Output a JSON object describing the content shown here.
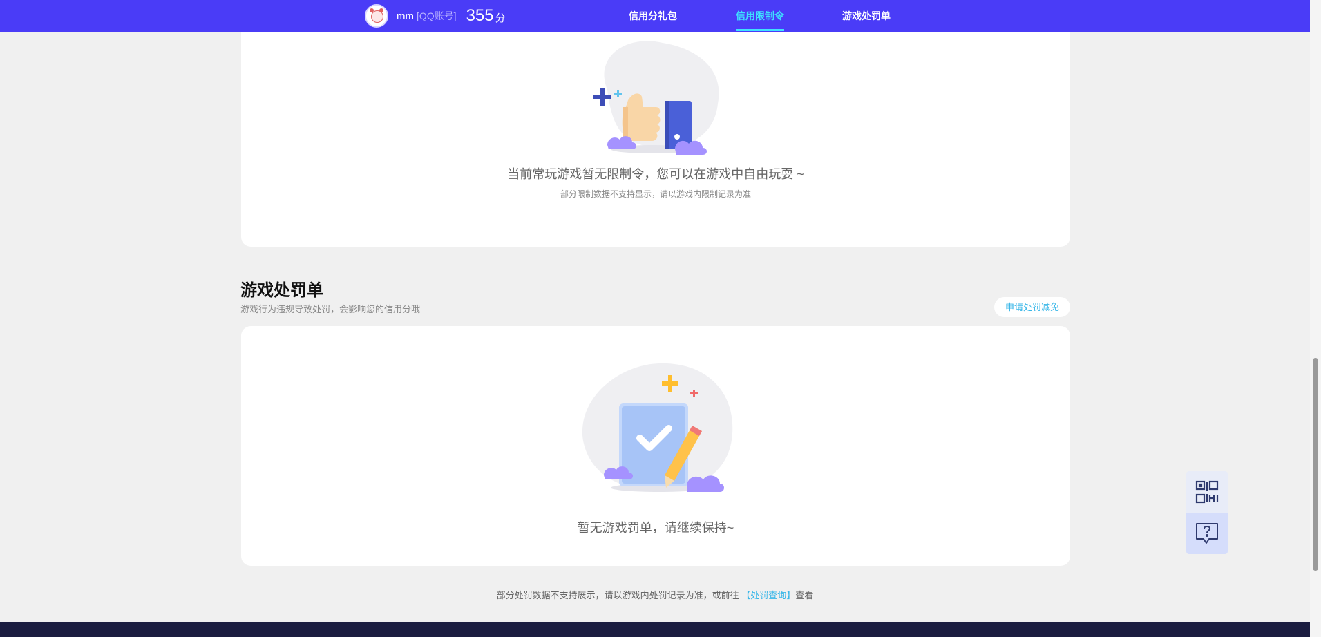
{
  "header": {
    "username": "mm",
    "account_type": "[QQ账号]",
    "score": "355",
    "score_unit": "分",
    "nav": [
      {
        "label": "信用分礼包",
        "active": false
      },
      {
        "label": "信用限制令",
        "active": true
      },
      {
        "label": "游戏处罚单",
        "active": false
      }
    ]
  },
  "restrictions": {
    "empty_message": "当前常玩游戏暂无限制令，您可以在游戏中自由玩耍 ~",
    "note": "部分限制数据不支持显示，请以游戏内限制记录为准"
  },
  "penalties": {
    "title": "游戏处罚单",
    "description": "游戏行为违规导致处罚，会影响您的信用分哦",
    "appeal_button": "申请处罚减免",
    "empty_message": "暂无游戏罚单，请继续保持~"
  },
  "footer": {
    "note_prefix": "部分处罚数据不支持展示，请以游戏内处罚记录为准，或前往",
    "note_link": "【处罚查询】",
    "note_suffix": "查看"
  },
  "colors": {
    "header_bg": "#4a3cf7",
    "active_nav": "#3ee0ff",
    "link": "#3ab7e8"
  },
  "icons": {
    "float_top": "qr-code-icon",
    "float_bottom": "help-chat-icon"
  }
}
